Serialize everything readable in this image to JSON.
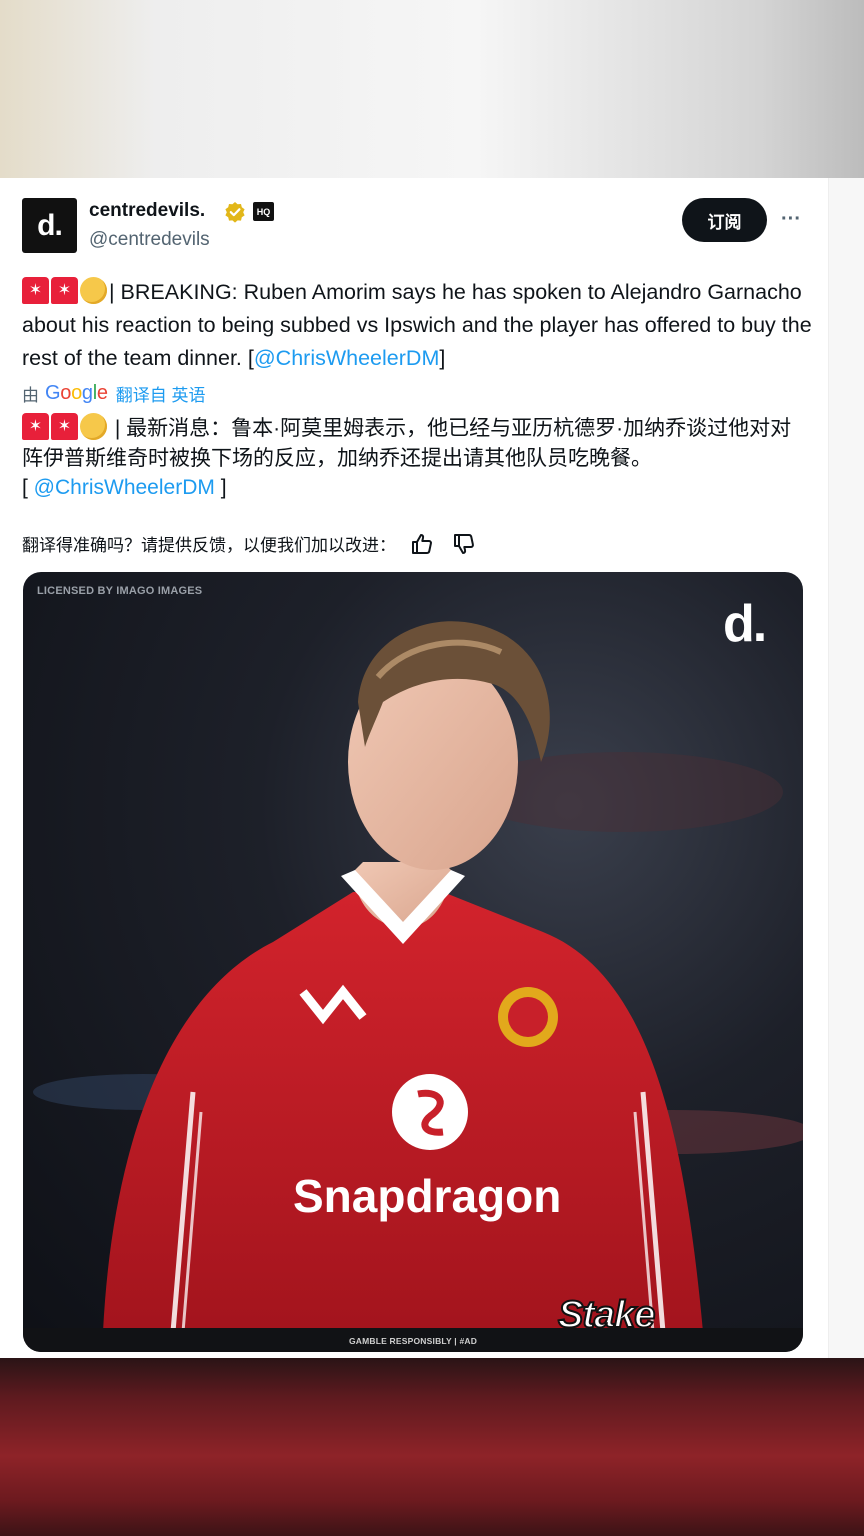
{
  "author": {
    "display_name": "centredevils.",
    "handle": "@centredevils",
    "avatar_glyph": "d.",
    "badge_text": "HQ"
  },
  "actions": {
    "subscribe_label": "订阅",
    "more_label": "···"
  },
  "tweet": {
    "text_before_link": "| BREAKING: Ruben Amorim says he has spoken to Alejandro Garnacho about his reaction to being subbed vs Ipswich and the player has offered to buy the rest of the team dinner. [",
    "link": "@ChrisWheelerDM",
    "text_after_link": "]"
  },
  "translation_bar": {
    "by": "由",
    "google": [
      "G",
      "o",
      "o",
      "g",
      "l",
      "e"
    ],
    "from": "翻译自 英语"
  },
  "translation": {
    "text": " | 最新消息：鲁本·阿莫里姆表示，他已经与亚历杭德罗·加纳乔谈过他对对阵伊普斯维奇时被换下场的反应，加纳乔还提出请其他队员吃晚餐。",
    "link_open": "[ ",
    "link": "@ChrisWheelerDM",
    "link_close": " ]"
  },
  "feedback": {
    "prompt": "翻译得准确吗？请提供反馈，以便我们加以改进："
  },
  "media": {
    "license_text": "LICENSED BY IMAGO IMAGES",
    "brand_mark": "d.",
    "footer_text": "GAMBLE RESPONSIBLY | #AD",
    "sponsor_logo": "Stake",
    "shirt_sponsor": "Snapdragon",
    "colors": {
      "shirt_red": "#c8202a",
      "background": "#15171d"
    }
  },
  "colors": {
    "link": "#1d9bf0",
    "text": "#0f1419",
    "muted": "#536471",
    "verified_gold": "#e2b719"
  }
}
